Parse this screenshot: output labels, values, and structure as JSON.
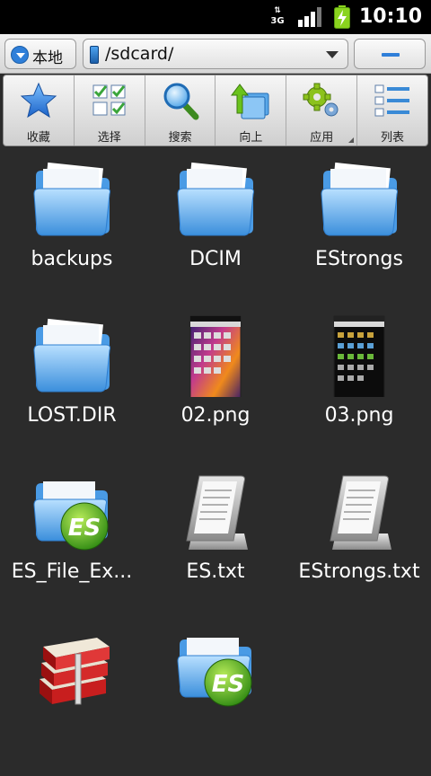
{
  "status_bar": {
    "time": "10:10",
    "network": "3G",
    "signal_icon": "signal-icon",
    "battery_icon": "battery-charging-icon"
  },
  "top_bar": {
    "location_label": "本地",
    "path": "/sdcard/"
  },
  "toolbar": {
    "items": [
      {
        "label": "收藏",
        "icon": "star-icon"
      },
      {
        "label": "选择",
        "icon": "select-icon"
      },
      {
        "label": "搜索",
        "icon": "search-icon"
      },
      {
        "label": "向上",
        "icon": "up-icon"
      },
      {
        "label": "应用",
        "icon": "gear-icon"
      },
      {
        "label": "列表",
        "icon": "list-icon"
      }
    ]
  },
  "files": [
    {
      "name": "backups",
      "type": "folder"
    },
    {
      "name": "DCIM",
      "type": "folder"
    },
    {
      "name": "EStrongs",
      "type": "folder"
    },
    {
      "name": "LOST.DIR",
      "type": "folder"
    },
    {
      "name": "02.png",
      "type": "image"
    },
    {
      "name": "03.png",
      "type": "image"
    },
    {
      "name": "ES_File_Ex...",
      "type": "app"
    },
    {
      "name": "ES.txt",
      "type": "text"
    },
    {
      "name": "EStrongs.txt",
      "type": "text"
    },
    {
      "name": "",
      "type": "archive"
    },
    {
      "name": "",
      "type": "app"
    }
  ],
  "colors": {
    "background": "#2b2b2b",
    "accent": "#2f7fd9"
  }
}
